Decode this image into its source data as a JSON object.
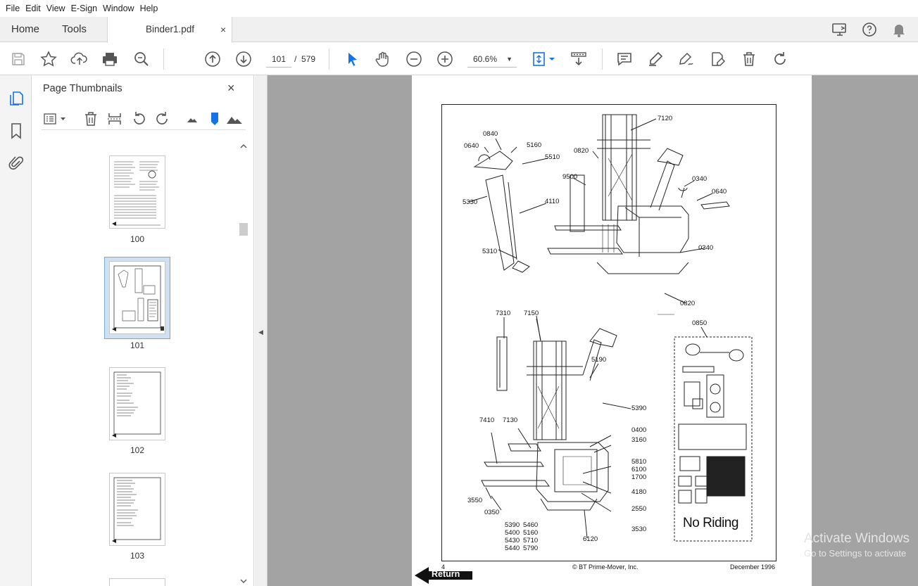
{
  "menu": [
    "File",
    "Edit",
    "View",
    "E-Sign",
    "Window",
    "Help"
  ],
  "tabs": {
    "home": "Home",
    "tools": "Tools",
    "document": "Binder1.pdf",
    "close_glyph": "×"
  },
  "toolbar": {
    "current_page": "101",
    "separator": "/",
    "total_pages": "579",
    "zoom": "60.6%"
  },
  "panel": {
    "title": "Page Thumbnails",
    "close_glyph": "×",
    "thumbnails": [
      {
        "label": "100"
      },
      {
        "label": "101",
        "selected": true
      },
      {
        "label": "102"
      },
      {
        "label": "103"
      }
    ]
  },
  "document": {
    "callouts_top": [
      "0840",
      "5160",
      "0640",
      "5510",
      "0820",
      "7120",
      "9500",
      "0340",
      "0640",
      "5330",
      "4110",
      "5310",
      "0340",
      "0820"
    ],
    "callouts_bottom": [
      "7310",
      "7150",
      "0850",
      "5190",
      "5390",
      "7410",
      "7130",
      "0400",
      "3160",
      "5810",
      "6100",
      "1700",
      "4180",
      "3550",
      "0350",
      "2550",
      "5390",
      "5460",
      "5400",
      "5160",
      "5430",
      "5710",
      "5440",
      "5790",
      "3530",
      "6120"
    ],
    "sticker_text": "No Riding",
    "footer_left": "4",
    "footer_center": "© BT Prime-Mover, Inc.",
    "footer_right": "December 1996",
    "return_label": "Return"
  },
  "watermark": {
    "line1": "Activate Windows",
    "line2": "Go to Settings to activate"
  },
  "colors": {
    "accent": "#1473e6",
    "doc_bg": "#a3a3a3",
    "panel_selected": "#cfe0f0"
  }
}
